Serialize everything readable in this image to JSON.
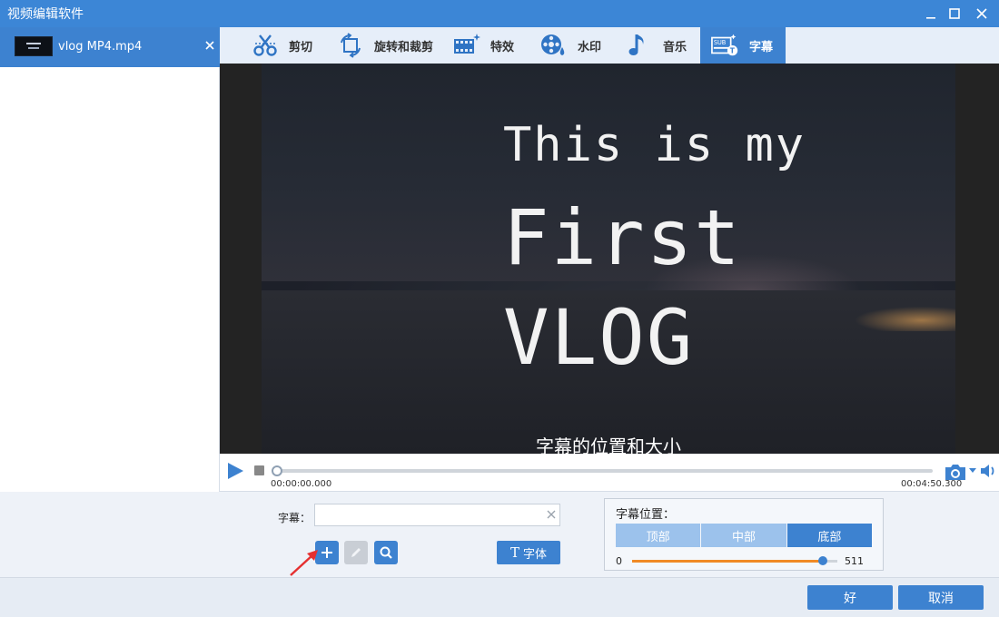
{
  "window": {
    "title": "视频编辑软件",
    "controls": [
      "minimize-icon",
      "maximize-icon",
      "close-icon"
    ]
  },
  "file_list": {
    "items": [
      {
        "name": "vlog MP4.mp4",
        "selected": true
      }
    ]
  },
  "tabs": [
    {
      "label": "剪切",
      "icon": "scissors-icon"
    },
    {
      "label": "旋转和裁剪",
      "icon": "rotate-crop-icon"
    },
    {
      "label": "特效",
      "icon": "effects-film-icon"
    },
    {
      "label": "水印",
      "icon": "watermark-icon"
    },
    {
      "label": "音乐",
      "icon": "music-note-icon"
    },
    {
      "label": "字幕",
      "icon": "subtitle-icon",
      "active": true
    }
  ],
  "preview": {
    "overlay_lines": [
      "This is my",
      "First",
      "VLOG"
    ],
    "subtitle_sample": "字幕的位置和大小"
  },
  "player": {
    "current_time": "00:00:00.000",
    "total_time": "00:04:50.300",
    "progress": 0
  },
  "subtitle_editor": {
    "label": "字幕：",
    "input_value": "",
    "input_placeholder": "",
    "font_button": "字体",
    "font_icon": "T",
    "action_icons": [
      "plus-icon",
      "pencil-icon",
      "magnifier-icon"
    ]
  },
  "position_panel": {
    "title": "字幕位置：",
    "options": [
      "顶部",
      "中部",
      "底部"
    ],
    "selected": "底部",
    "slider": {
      "min": "0",
      "max": "511",
      "value": 511
    }
  },
  "footer": {
    "ok": "好",
    "cancel": "取消"
  },
  "colors": {
    "accent": "#3d82d0",
    "titlebar": "#3c86d6",
    "slider_fill": "#f08a26",
    "arrow": "#e53030"
  }
}
